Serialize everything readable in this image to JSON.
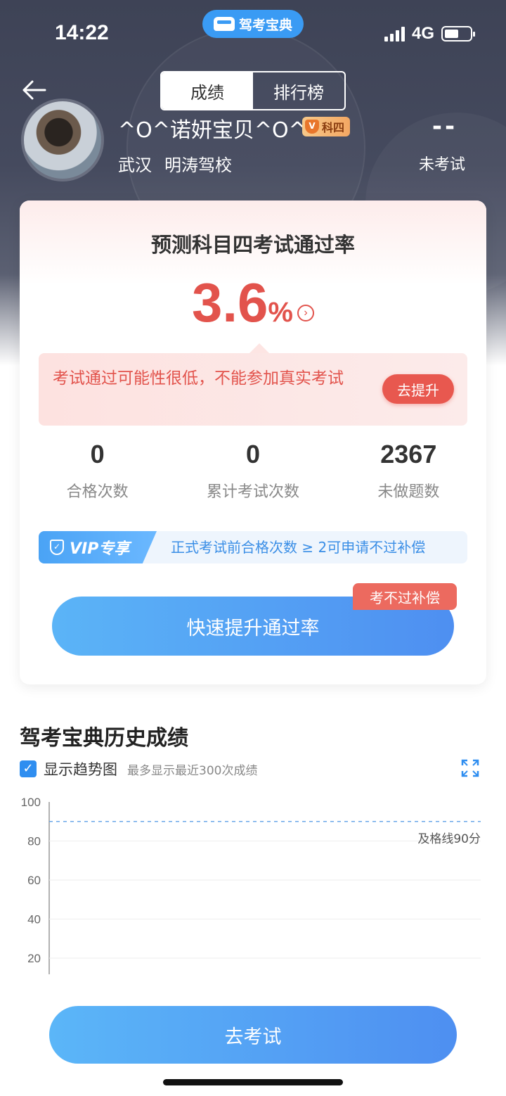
{
  "status_bar": {
    "time": "14:22",
    "network": "4G",
    "battery_level": 0.55
  },
  "app_pill": {
    "label": "驾考宝典",
    "icon": "car-icon"
  },
  "tabs": {
    "active": "成绩",
    "inactive": "排行榜"
  },
  "profile": {
    "nickname": "^O^诺妍宝贝^O^",
    "badge": "科四",
    "city": "武汉",
    "school": "明涛驾校",
    "score": "--",
    "score_label": "未考试"
  },
  "card": {
    "title": "预测科目四考试通过率",
    "rate_value": "3.6",
    "rate_unit": "%",
    "warning_text": "考试通过可能性很低，不能参加真实考试",
    "improve_button": "去提升",
    "stats": [
      {
        "value": "0",
        "label": "合格次数"
      },
      {
        "value": "0",
        "label": "累计考试次数"
      },
      {
        "value": "2367",
        "label": "未做题数"
      }
    ],
    "vip_tag": "VIP专享",
    "vip_text": "正式考试前合格次数 ≥ 2可申请不过补偿",
    "main_button": "快速提升通过率",
    "corner_tag": "考不过补偿"
  },
  "history": {
    "title": "驾考宝典历史成绩",
    "checkbox_label": "显示趋势图",
    "checkbox_checked": true,
    "subtitle": "最多显示最近300次成绩"
  },
  "chart_data": {
    "type": "line",
    "y_ticks": [
      "100",
      "80",
      "60",
      "40",
      "20"
    ],
    "ylim": [
      0,
      100
    ],
    "pass_line": 90,
    "pass_line_label": "及格线90分",
    "series": [],
    "grid": true
  },
  "bottom_button": "去考试",
  "colors": {
    "accent_blue": "#4e8ff1",
    "warning_red": "#e2534c",
    "header_dark": "#3e4356"
  }
}
